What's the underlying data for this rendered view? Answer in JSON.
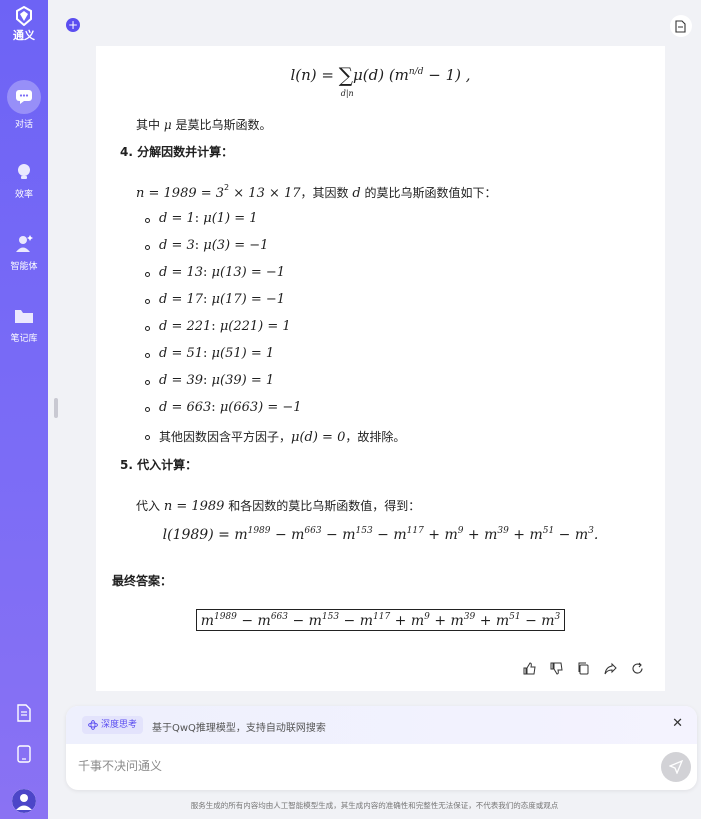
{
  "app": {
    "name": "通义"
  },
  "sidebar": {
    "items": [
      {
        "label": "对话",
        "icon": "chat-icon",
        "active": true
      },
      {
        "label": "效率",
        "icon": "lightbulb-icon"
      },
      {
        "label": "智能体",
        "icon": "agent-icon"
      },
      {
        "label": "笔记库",
        "icon": "folder-icon"
      }
    ]
  },
  "content": {
    "formula_top_lhs": "l(n) = ",
    "formula_top_sum": "∑",
    "formula_top_sub": "d|n",
    "formula_top_body": "μ(d) (m",
    "formula_top_exp": "n/d",
    "formula_top_tail": " − 1) ,",
    "mu_note_prefix": "其中 ",
    "mu_symbol": "μ",
    "mu_note_suffix": " 是莫比乌斯函数。",
    "step4_title": "4. 分解因数并计算：",
    "factor_line_math": "n = 1989 = 3",
    "factor_line_exp": "2",
    "factor_line_rest": " × 13 × 17",
    "factor_line_text1": "，其因数 ",
    "factor_line_d": "d",
    "factor_line_text2": " 的莫比乌斯函数值如下：",
    "divisors": [
      {
        "d": "d = 1",
        "mu": "μ(1) = 1"
      },
      {
        "d": "d = 3",
        "mu": "μ(3) = −1"
      },
      {
        "d": "d = 13",
        "mu": "μ(13) = −1"
      },
      {
        "d": "d = 17",
        "mu": "μ(17) = −1"
      },
      {
        "d": "d = 221",
        "mu": "μ(221) = 1"
      },
      {
        "d": "d = 51",
        "mu": "μ(51) = 1"
      },
      {
        "d": "d = 39",
        "mu": "μ(39) = 1"
      },
      {
        "d": "d = 663",
        "mu": "μ(663) = −1"
      }
    ],
    "other_factors_text1": "其他因数因含平方因子，",
    "other_factors_math": "μ(d) = 0",
    "other_factors_text2": "，故排除。",
    "step5_title": "5. 代入计算：",
    "substitute_text1": "代入 ",
    "substitute_math": "n = 1989",
    "substitute_text2": " 和各因数的莫比乌斯函数值，得到：",
    "result_lhs": "l(1989) = ",
    "result_terms": [
      {
        "sign": "",
        "exp": "1989"
      },
      {
        "sign": " − ",
        "exp": "663"
      },
      {
        "sign": " − ",
        "exp": "153"
      },
      {
        "sign": " − ",
        "exp": "117"
      },
      {
        "sign": " + ",
        "exp": "9"
      },
      {
        "sign": " + ",
        "exp": "39"
      },
      {
        "sign": " + ",
        "exp": "51"
      },
      {
        "sign": " − ",
        "exp": "3"
      }
    ],
    "base": "m",
    "result_end": ".",
    "final_answer_title": "最终答案："
  },
  "actions": [
    "thumbs-up-icon",
    "thumbs-down-icon",
    "copy-icon",
    "share-icon",
    "refresh-icon"
  ],
  "input": {
    "deep_think_label": "深度思考",
    "hint": "基于QwQ推理模型，支持自动联网搜索",
    "placeholder": "千事不决问通义"
  },
  "footer": "服务生成的所有内容均由人工智能模型生成，其生成内容的准确性和完整性无法保证，不代表我们的态度或观点"
}
